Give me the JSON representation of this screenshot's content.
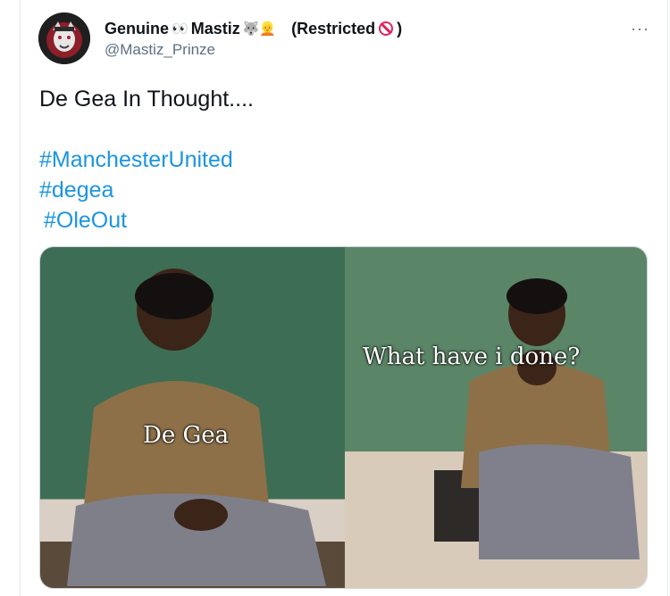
{
  "tweet": {
    "display_name_1": "Genuine",
    "display_name_eyes": "👀",
    "display_name_2": "Mastiz",
    "display_name_emoji": "🐺👱",
    "restricted_label": "(Restricted",
    "restricted_close": ")",
    "handle": "@Mastiz_Prinze",
    "more_label": "···",
    "text": "De Gea In Thought....",
    "hashtags": [
      "#ManchesterUnited",
      "#degea",
      "#OleOut"
    ],
    "media": {
      "left_caption": "De Gea",
      "right_caption": "What have i done?"
    }
  },
  "colors": {
    "link": "#1b95e0",
    "muted": "#5b7083",
    "restricted_icon": "#e0245e"
  }
}
